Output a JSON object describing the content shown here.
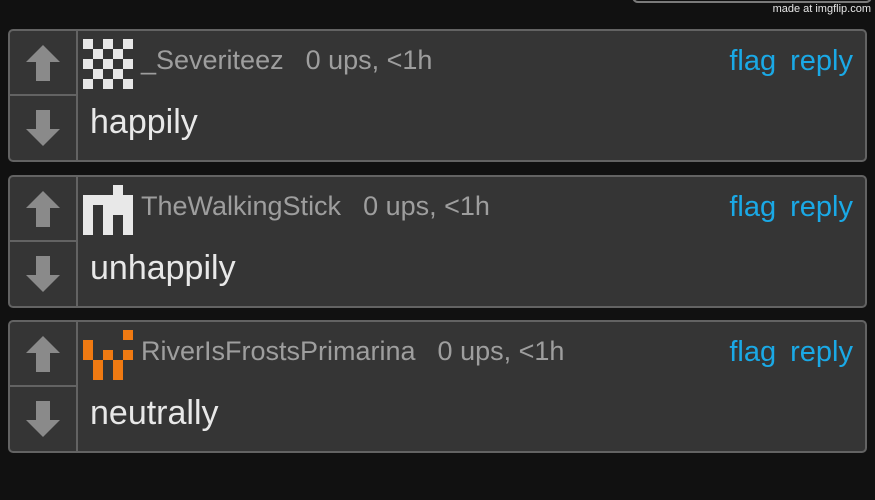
{
  "watermark": "made at imgflip.com",
  "colors": {
    "background": "#111111",
    "card": "#353535",
    "border": "#636363",
    "link": "#1aa9e6",
    "meta_text": "#9e9e9e",
    "body_text": "#e8e8e8",
    "vote_icon": "#8a8a8a"
  },
  "comments": [
    {
      "username": "_Severiteez",
      "stats": "0 ups, <1h",
      "flag": "flag",
      "reply": "reply",
      "text": "happily",
      "avatar_icon": "identicon-checker-white",
      "avatar_color": "#e8e8e8"
    },
    {
      "username": "TheWalkingStick",
      "stats": "0 ups, <1h",
      "flag": "flag",
      "reply": "reply",
      "text": "unhappily",
      "avatar_icon": "identicon-cross-white",
      "avatar_color": "#e8e8e8"
    },
    {
      "username": "RiverIsFrostsPrimarina",
      "stats": "0 ups, <1h",
      "flag": "flag",
      "reply": "reply",
      "text": "neutrally",
      "avatar_icon": "identicon-smile-orange",
      "avatar_color": "#f07a12"
    }
  ]
}
